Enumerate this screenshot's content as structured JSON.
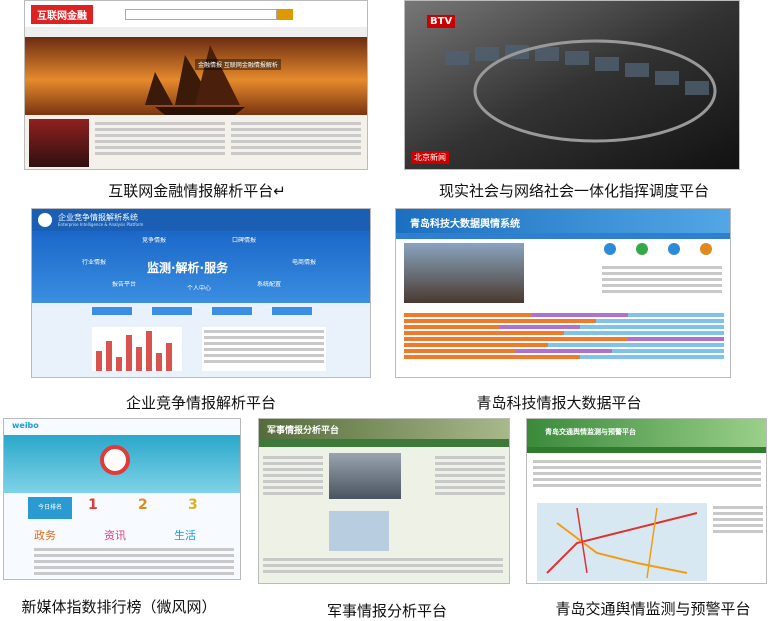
{
  "panels": [
    {
      "caption": "互联网金融情报解析平台↵",
      "logo": "互联网金融",
      "banner_text": "金融情报 互联网金融情报解析"
    },
    {
      "caption": "现实社会与网络社会一体化指挥调度平台",
      "logo": "BTV",
      "corner_logo": "北京新闻"
    },
    {
      "caption": "企业竞争情报解析平台",
      "title": "企业竞争情报解析系统",
      "subtitle": "Enterprise Intelligence & Analysis Platform",
      "nodes": [
        "竞争情报",
        "口碑情报",
        "行业情报",
        "电商情报",
        "报告平台",
        "个人中心",
        "系统配置"
      ],
      "center_text": "监测·解析·服务"
    },
    {
      "caption": "青岛科技情报大数据平台",
      "title": "青岛科技大数据舆情系统"
    },
    {
      "caption": "新媒体指数排行榜（微风网）",
      "logo": "weibo",
      "cards": [
        "今日排名",
        "1",
        "2",
        "3"
      ],
      "cats": [
        "政务",
        "资讯",
        "生活"
      ]
    },
    {
      "caption": "军事情报分析平台",
      "title": "军事情报分析平台"
    },
    {
      "caption": "青岛交通舆情监测与预警平台",
      "title": "青岛交通舆情监测与预警平台"
    }
  ],
  "colors": {
    "accent": "#1a5fb4",
    "red": "#d9534f",
    "green": "#3d7a3a",
    "teal": "#2aa7c9"
  }
}
